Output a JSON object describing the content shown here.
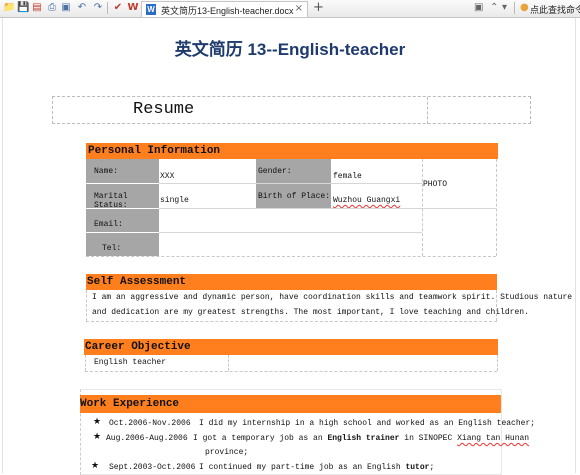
{
  "toolbar": {
    "icons": [
      "open-folder-icon",
      "save-icon",
      "export-pdf-icon",
      "print-icon",
      "print-preview-icon",
      "undo-icon",
      "redo-icon",
      "format-painter-icon",
      "wps-icon"
    ],
    "tab_label": "英文简历13-English-teacher.docx",
    "tab_close": "×",
    "tab_add": "+",
    "command_search": "点此查找命令"
  },
  "document": {
    "title": "英文简历 13--English-teacher",
    "resume_heading": "Resume",
    "personal": {
      "header": "Personal Information",
      "name_label": "Name:",
      "name_value": "XXX",
      "gender_label": "Gender:",
      "gender_value": "female",
      "photo_label": "PHOTO",
      "marital_label": "Marital Status:",
      "marital_value": "single",
      "birth_label": "Birth of Place:",
      "birth_value": "Wuzhou Guangxi",
      "email_label": "Email:",
      "tel_label": "Tel:"
    },
    "self_assessment": {
      "header": "Self Assessment",
      "line1": "I am an aggressive and dynamic person, have coordination skills and teamwork spirit. Studious nature",
      "line2": "and dedication are my greatest strengths. The most important, I love teaching and children."
    },
    "career": {
      "header": "Career Objective",
      "value": "English teacher"
    },
    "work": {
      "header": "Work Experience",
      "items": [
        {
          "date": "Oct.2006-Nov.2006",
          "text": "I did my internship in a high school and worked as an English teacher;"
        },
        {
          "date": "Aug.2006-Aug.2006",
          "text_pre": "I got a temporary job as an",
          "bold": "English trainer",
          "text_post": "in SINOPEC",
          "place": "Xiang tan Hunan",
          "cont": "province;"
        },
        {
          "date": "Sept.2003-Oct.2006",
          "text_pre": "I continued my part-time job as an English",
          "bold": "tutor",
          "text_post": ";"
        }
      ]
    }
  }
}
